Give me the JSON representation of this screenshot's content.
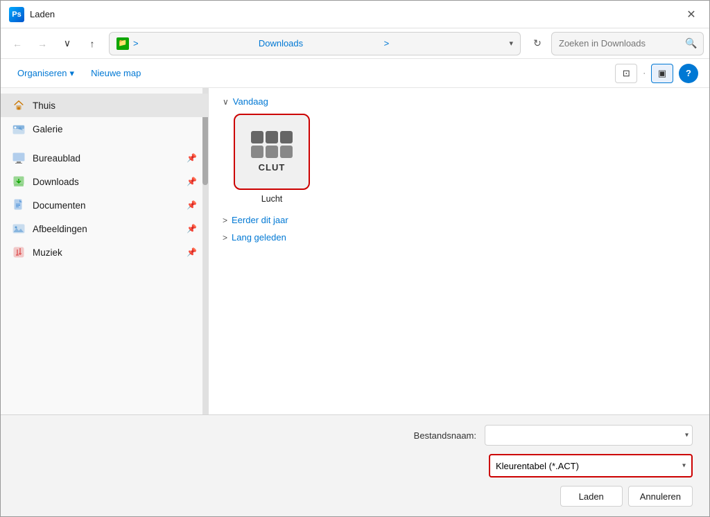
{
  "window": {
    "title": "Laden",
    "app_icon": "Ps",
    "close_label": "✕"
  },
  "navbar": {
    "back_label": "←",
    "forward_label": "→",
    "dropdown_label": "∨",
    "up_label": "↑",
    "folder_icon": "📁",
    "path_prefix": ">",
    "path_name": "Downloads",
    "path_suffix": ">",
    "refresh_label": "↻",
    "search_placeholder": "Zoeken in Downloads",
    "search_icon": "🔍"
  },
  "toolbar": {
    "organize_label": "Organiseren",
    "organize_arrow": "▾",
    "new_folder_label": "Nieuwe map",
    "view_icon_label": "⊡",
    "view_panel_label": "▣",
    "help_label": "?"
  },
  "sidebar": {
    "items": [
      {
        "id": "thuis",
        "label": "Thuis",
        "icon": "home",
        "active": true,
        "pin": false
      },
      {
        "id": "galerie",
        "label": "Galerie",
        "icon": "gallery",
        "active": false,
        "pin": false
      },
      {
        "id": "bureaubald",
        "label": "Bureaublad",
        "icon": "desktop",
        "active": false,
        "pin": true
      },
      {
        "id": "downloads",
        "label": "Downloads",
        "icon": "download",
        "active": false,
        "pin": true
      },
      {
        "id": "documenten",
        "label": "Documenten",
        "icon": "documents",
        "active": false,
        "pin": true
      },
      {
        "id": "afbeeldingen",
        "label": "Afbeeldingen",
        "icon": "images",
        "active": false,
        "pin": true
      },
      {
        "id": "muziek",
        "label": "Muziek",
        "icon": "music",
        "active": false,
        "pin": true
      }
    ]
  },
  "file_area": {
    "sections": [
      {
        "id": "vandaag",
        "title": "Vandaag",
        "expanded": true,
        "chevron": "∨",
        "files": [
          {
            "id": "lucht",
            "name": "Lucht",
            "type": "CLUT",
            "selected": true
          }
        ]
      },
      {
        "id": "eerder-dit-jaar",
        "title": "Eerder dit jaar",
        "expanded": false,
        "chevron": ">"
      },
      {
        "id": "lang-geleden",
        "title": "Lang geleden",
        "expanded": false,
        "chevron": ">"
      }
    ]
  },
  "bottom": {
    "filename_label": "Bestandsnaam:",
    "filename_value": "",
    "filename_placeholder": "",
    "filetype_label": "",
    "filetype_value": "Kleurentabel (*.ACT)",
    "filetype_options": [
      "Kleurentabel (*.ACT)"
    ],
    "load_label": "Laden",
    "cancel_label": "Annuleren"
  }
}
